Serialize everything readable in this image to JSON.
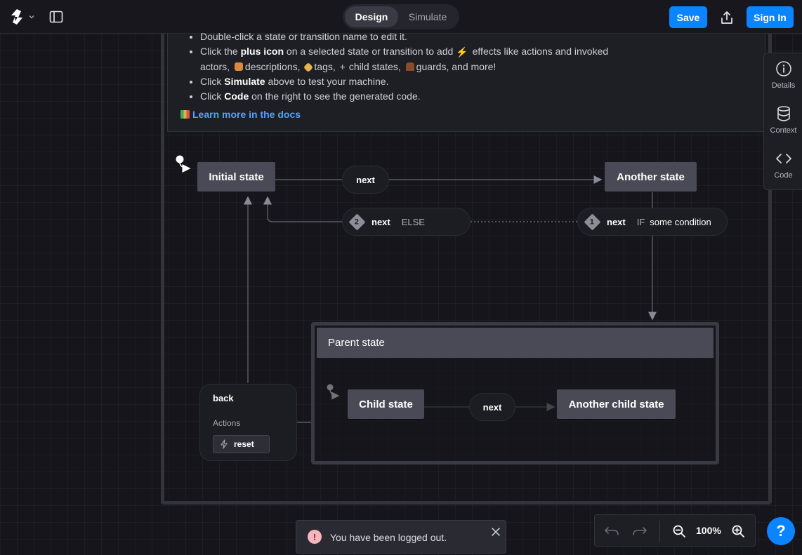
{
  "topbar": {
    "modes": [
      {
        "label": "Design",
        "active": true
      },
      {
        "label": "Simulate",
        "active": false
      }
    ],
    "save_label": "Save",
    "signin_label": "Sign In"
  },
  "info": {
    "line1": "Double-click a state or transition name to edit it.",
    "line2_pre": "Click the ",
    "line2_bold": "plus icon",
    "line2_mid": " on a selected state or transition to add ",
    "line2_effects": "effects like actions and invoked",
    "line2_actors": "actors, ",
    "line2_desc": "descriptions, ",
    "line2_tags": "tags, ",
    "line2_child": "child states, ",
    "line2_guards": "guards, and more!",
    "line3_pre": "Click ",
    "line3_bold": "Simulate",
    "line3_post": " above to test your machine.",
    "line4_pre": "Click ",
    "line4_bold": "Code",
    "line4_post": " on the right to see the generated code.",
    "docs_link": "Learn more in the docs"
  },
  "diagram": {
    "states": {
      "initial": "Initial state",
      "another": "Another state",
      "parent": "Parent state",
      "child": "Child state",
      "another_child": "Another child state"
    },
    "transitions": {
      "next_top": "next",
      "next_else": {
        "index": "2",
        "event": "next",
        "guard": "ELSE"
      },
      "next_if": {
        "index": "1",
        "event": "next",
        "keyword": "IF",
        "guard": "some condition"
      },
      "next_child": "next"
    },
    "back_card": {
      "event": "back",
      "actions_label": "Actions",
      "action": "reset"
    }
  },
  "right_panel": [
    {
      "label": "Details",
      "icon": "info-icon"
    },
    {
      "label": "Context",
      "icon": "database-icon"
    },
    {
      "label": "Code",
      "icon": "code-icon"
    }
  ],
  "zoom": {
    "value": "100%"
  },
  "toast": {
    "message": "You have been logged out."
  },
  "help_label": "?",
  "colors": {
    "accent": "#0a84ff",
    "state_fill": "#4a4a56",
    "canvas": "#15151b"
  }
}
